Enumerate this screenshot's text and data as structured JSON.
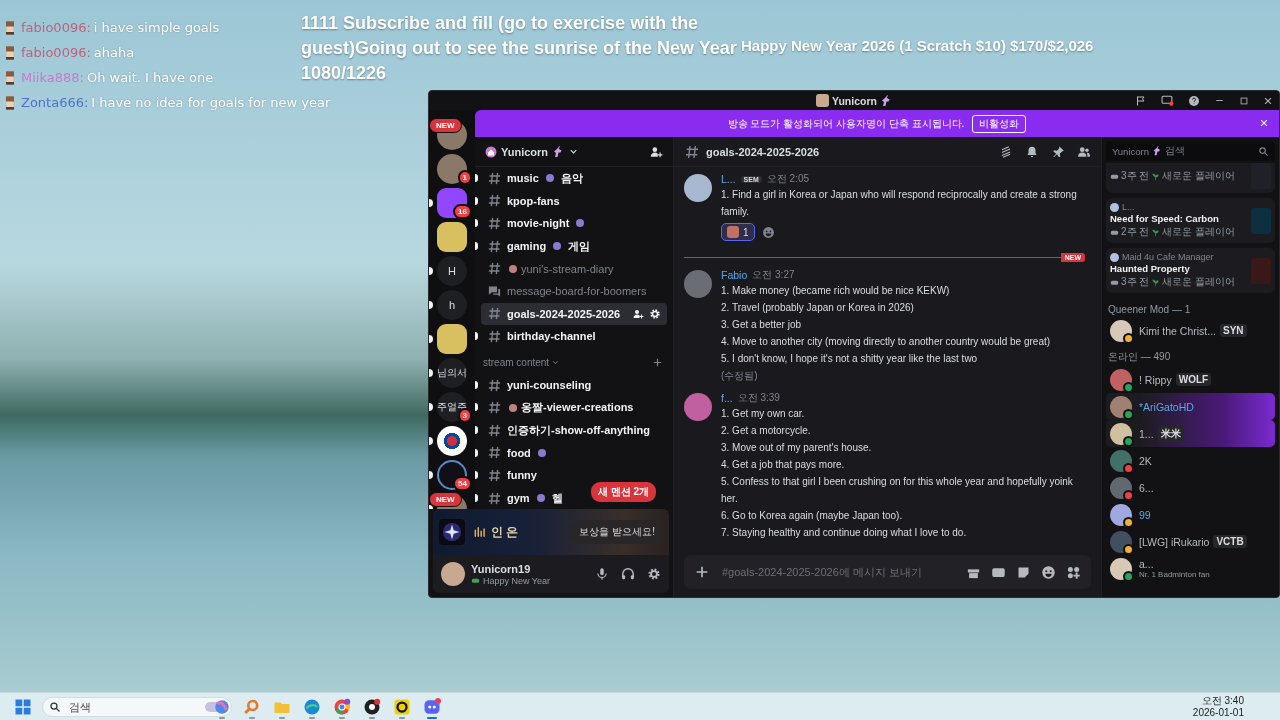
{
  "stream_chat": [
    {
      "user": "fabio0096:",
      "message": "i have simple goals",
      "color": "#c0607a"
    },
    {
      "user": "fabio0096:",
      "message": "ahaha",
      "color": "#c0607a"
    },
    {
      "user": "Miika888:",
      "message": "Oh wait. I have one",
      "color": "#c77ac8"
    },
    {
      "user": "Zonta666:",
      "message": "I have no idea for goals for new year",
      "color": "#4f72c8"
    }
  ],
  "goal_overlay": "1111 Subscribe and fill (go to exercise with the guest)Going out to see the sunrise of the New Year 1080/1226",
  "donation_overlay": "Happy New Year 2026 (1 Scratch $10) $170/$2,026",
  "window": {
    "title": "Yunicorn"
  },
  "banner": {
    "text": "방송 모드가 활성화되어 사용자명이 단축 표시됩니다.",
    "button": "비활성화"
  },
  "servers": [
    {
      "kind": "avatar",
      "unread": false,
      "ribbon": "NEW"
    },
    {
      "kind": "avatar",
      "unread": false,
      "badge": "1"
    },
    {
      "kind": "twitch",
      "unread": true,
      "badge": "16"
    },
    {
      "kind": "picture",
      "unread": false
    },
    {
      "kind": "letter",
      "label": "H",
      "unread": true
    },
    {
      "kind": "letter",
      "label": "h",
      "unread": true
    },
    {
      "kind": "picture",
      "unread": true
    },
    {
      "kind": "letter",
      "label": "님의서",
      "unread": true
    },
    {
      "kind": "letter",
      "label": "주얼주",
      "unread": true,
      "badge": "3"
    },
    {
      "kind": "flag",
      "unread": true
    },
    {
      "kind": "compass",
      "unread": true,
      "badge": "54"
    },
    {
      "kind": "avatar",
      "unread": true,
      "ribbon": "NEW"
    }
  ],
  "server_header": {
    "name": "Yunicorn"
  },
  "channels": [
    {
      "kind": "text",
      "name": "music",
      "lead_emoji": false,
      "trail_emoji": true,
      "tail": "음악",
      "unread": true,
      "selected": false
    },
    {
      "kind": "text",
      "name": "kpop-fans",
      "lead_emoji": false,
      "trail_emoji": false,
      "unread": true,
      "selected": false
    },
    {
      "kind": "text",
      "name": "movie-night",
      "lead_emoji": false,
      "trail_emoji": true,
      "unread": true,
      "selected": false
    },
    {
      "kind": "text",
      "name": "gaming",
      "lead_emoji": false,
      "trail_emoji": true,
      "tail": "게임",
      "unread": true,
      "selected": false
    },
    {
      "kind": "text",
      "name": "yuni's-stream-diary",
      "lead_emoji": true,
      "trail_emoji": false,
      "unread": false,
      "selected": false
    },
    {
      "kind": "forum",
      "name": "message-board-for-boomers",
      "lead_emoji": false,
      "trail_emoji": false,
      "unread": false,
      "selected": false
    },
    {
      "kind": "text",
      "name": "goals-2024-2025-2026",
      "lead_emoji": false,
      "trail_emoji": false,
      "unread": false,
      "selected": true
    },
    {
      "kind": "text",
      "name": "birthday-channel",
      "lead_emoji": false,
      "trail_emoji": false,
      "unread": true,
      "selected": false
    },
    {
      "kind": "category",
      "name": "stream content",
      "unread": false,
      "selected": false
    },
    {
      "kind": "text",
      "name": "yuni-counseling",
      "lead_emoji": false,
      "trail_emoji": false,
      "unread": true,
      "selected": false
    },
    {
      "kind": "text",
      "name": "옹짤-viewer-creations",
      "lead_emoji": true,
      "trail_emoji": false,
      "unread": true,
      "selected": false
    },
    {
      "kind": "text",
      "name": "인증하기-show-off-anything",
      "lead_emoji": false,
      "trail_emoji": false,
      "unread": true,
      "selected": false
    },
    {
      "kind": "text",
      "name": "food",
      "lead_emoji": false,
      "trail_emoji": true,
      "unread": true,
      "selected": false
    },
    {
      "kind": "text",
      "name": "funny",
      "lead_emoji": false,
      "trail_emoji": false,
      "unread": true,
      "selected": false
    },
    {
      "kind": "text",
      "name": "gym",
      "lead_emoji": false,
      "trail_emoji": true,
      "tail": "헬",
      "unread": true,
      "selected": false
    }
  ],
  "mention_pill": "새 멘션 2개",
  "promo": {
    "title": "인 온",
    "button": "보상을 받으세요!"
  },
  "user_panel": {
    "name": "Yunicorn19",
    "status": "Happy New Year"
  },
  "channel_header": {
    "name": "goals-2024-2025-2026"
  },
  "messages": [
    {
      "kind": "message",
      "author": "L...",
      "tag": "SEM",
      "time": "오전 2:05",
      "lines": [
        "1. Find a girl in Korea or Japan who will respond reciprocally and create a strong family."
      ],
      "reactions": [
        {
          "count": "1",
          "selected": true
        }
      ]
    },
    {
      "kind": "divider",
      "label": "NEW"
    },
    {
      "kind": "message",
      "author": "Fabio",
      "time": "오전 3:27",
      "lines": [
        "1. Make money (became rich would be nice KEKW)",
        "2. Travel (probably Japan or Korea in 2026)",
        "3. Get a better job",
        "4. Move to another city (moving directly to another country would be great)",
        "5. I don't know, I hope it's not a shitty year like the last two"
      ],
      "edited": "(수정됨)"
    },
    {
      "kind": "message",
      "author": "f...",
      "time": "오전 3:39",
      "lines": [
        "1. Get my own car.",
        "2. Get a motorcycle.",
        "3. Move out of my parent's house.",
        "4. Get a job that pays more.",
        "5. Confess to that girl I been crushing on for this whole year and hopefully yoink her.",
        "6. Go to Korea again (maybe Japan too).",
        "7. Staying healthy and continue doing what I love to do."
      ]
    }
  ],
  "composer": {
    "placeholder": "#goals-2024-2025-2026에 메시지 보내기"
  },
  "member_search": {
    "scope": "Yunicorn",
    "placeholder": "검색"
  },
  "activities": [
    {
      "ago": "3주 전",
      "note": "새로운 플레이어"
    },
    {
      "user": "L...",
      "game": "Need for Speed: Carbon",
      "ago": "2주 전",
      "note": "새로운 플레이어"
    },
    {
      "user": "Maid 4u Cafe Manager",
      "game": "Haunted Property",
      "ago": "3주 전",
      "note": "새로운 플레이어"
    }
  ],
  "member_groups": [
    {
      "title": "Queener Mod — 1",
      "members": [
        {
          "name": "Kimi the Christ...",
          "tag": "SYN",
          "color": "#f0b232",
          "nameplate": false,
          "role_color": false
        }
      ]
    },
    {
      "title": "온라인 — 490",
      "members": [
        {
          "name": "! Rippy",
          "tag": "WOLF",
          "color": "#23a55a",
          "nameplate": false,
          "role_color": false
        },
        {
          "name": "*AriGatoHD",
          "color": "#23a55a",
          "nameplate": true,
          "role_color": true
        },
        {
          "name": "1...",
          "tag": "米米",
          "color": "#23a55a",
          "nameplate": true,
          "role_color": false
        },
        {
          "name": "2K",
          "color": "#f23f43",
          "nameplate": false,
          "role_color": false
        },
        {
          "name": "6...",
          "color": "#f23f43",
          "nameplate": false,
          "role_color": false
        },
        {
          "name": "99",
          "color": "#f0b232",
          "nameplate": false,
          "role_color": true
        },
        {
          "name": "[LWG] iRukario",
          "tag": "VCTB",
          "color": "#f0b232",
          "nameplate": false,
          "role_color": false
        },
        {
          "name": "a...",
          "activity": "Nr. 1 Badminton fan",
          "color": "#23a55a",
          "nameplate": false,
          "role_color": false
        }
      ]
    }
  ],
  "taskbar": {
    "search_placeholder": "검색",
    "apps": [
      {
        "kind": "copilot",
        "active": false
      },
      {
        "kind": "magnifier",
        "active": false
      },
      {
        "kind": "folder",
        "active": false
      },
      {
        "kind": "browser",
        "active": false
      },
      {
        "kind": "chrome",
        "active": false
      },
      {
        "kind": "recorder",
        "active": false
      },
      {
        "kind": "ring",
        "active": false
      },
      {
        "kind": "chat",
        "active": true
      }
    ],
    "time": "오전 3:40",
    "date": "2026-01-01"
  }
}
